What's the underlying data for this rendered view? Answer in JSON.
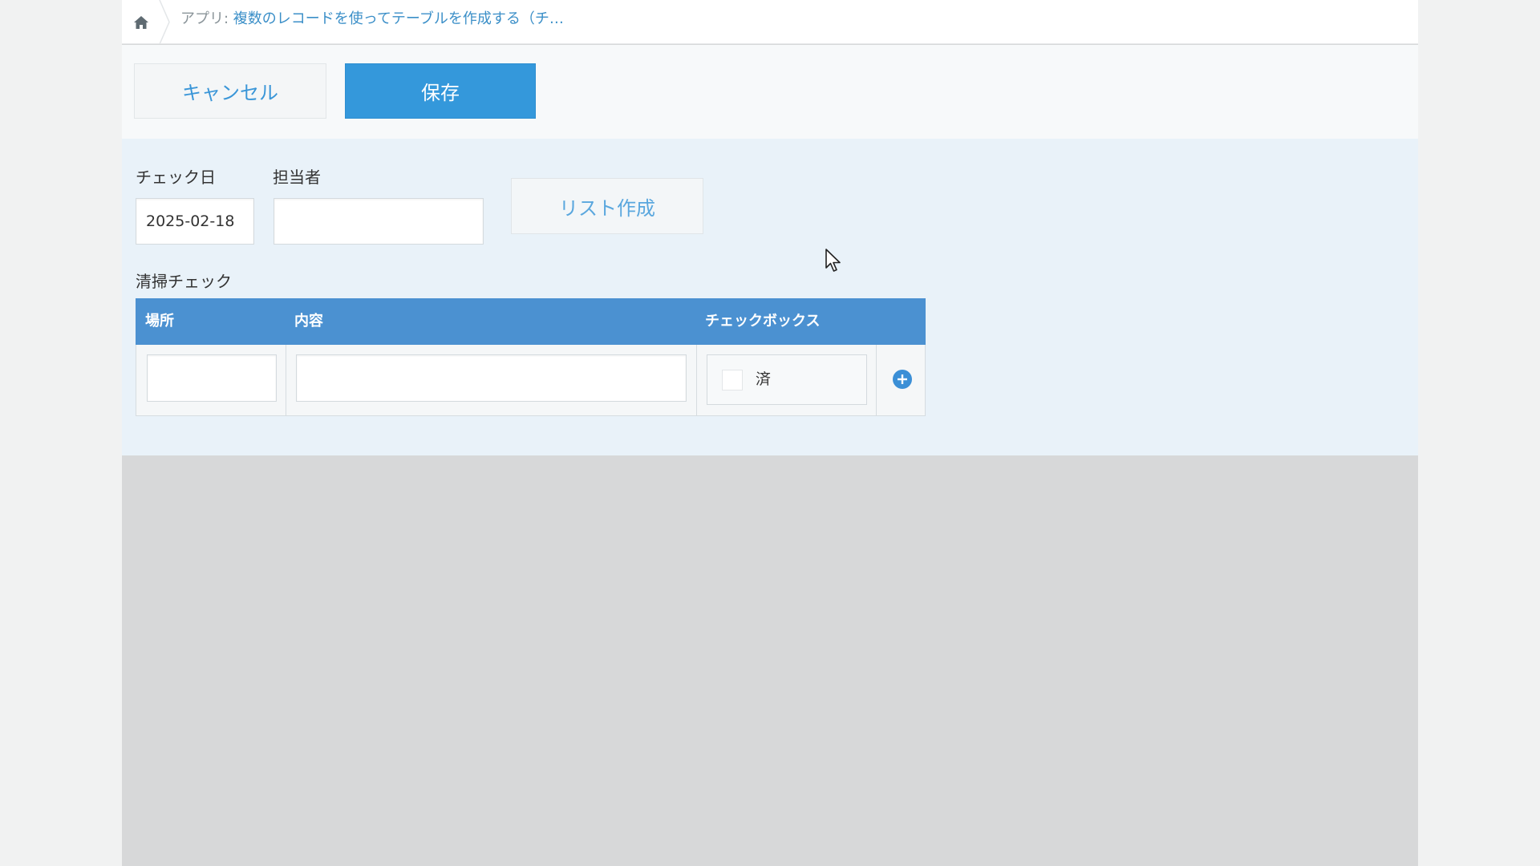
{
  "breadcrumb": {
    "prefix": "アプリ: ",
    "app_name": "複数のレコードを使ってテーブルを作成する（チ…"
  },
  "toolbar": {
    "cancel_label": "キャンセル",
    "save_label": "保存"
  },
  "form": {
    "check_date": {
      "label": "チェック日",
      "value": "2025-02-18"
    },
    "assignee": {
      "label": "担当者",
      "value": ""
    },
    "list_button_label": "リスト作成"
  },
  "subtable": {
    "title": "清掃チェック",
    "columns": [
      "場所",
      "内容",
      "チェックボックス"
    ],
    "rows": [
      {
        "place": "",
        "content": "",
        "checkbox": {
          "option_label": "済",
          "checked": false
        }
      }
    ]
  },
  "colors": {
    "primary": "#3498db",
    "table_header": "#4b91d1",
    "form_background": "#e9f2f9",
    "link": "#3b8fc8"
  },
  "icons": {
    "home": "home-icon",
    "add_row": "plus-circle-icon",
    "cursor": "mouse-pointer-icon"
  }
}
